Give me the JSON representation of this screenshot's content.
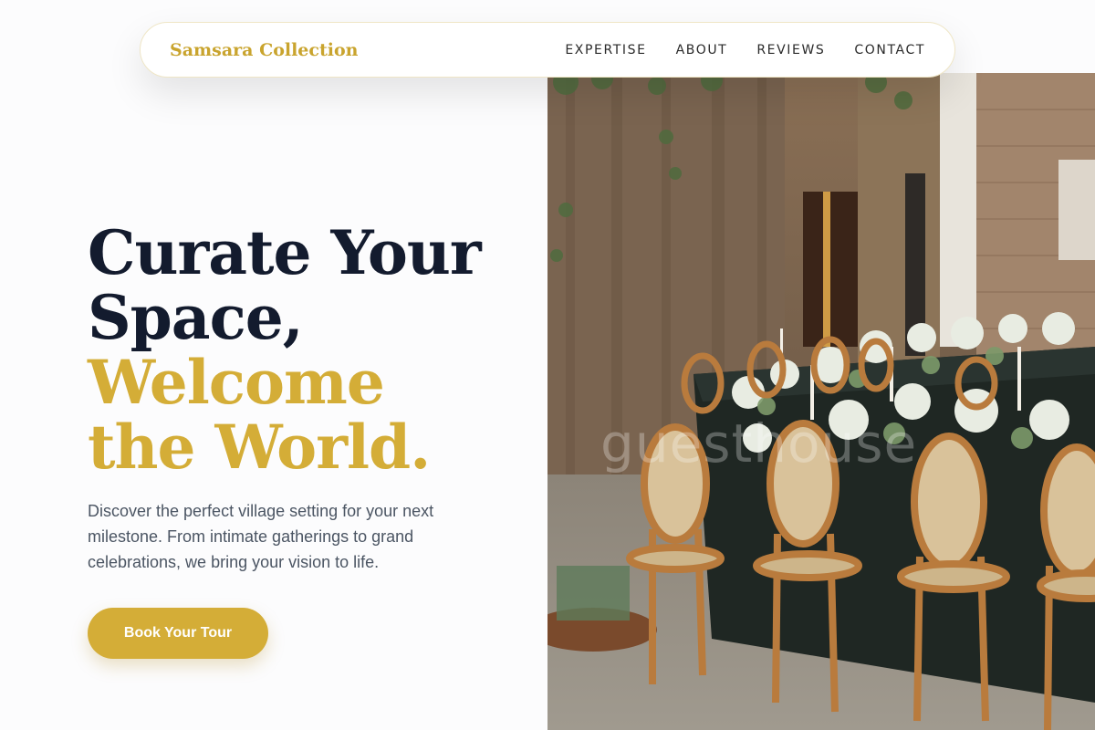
{
  "nav": {
    "brand": "Samsara Collection",
    "links": [
      "EXPERTISE",
      "ABOUT",
      "REVIEWS",
      "CONTACT"
    ]
  },
  "hero": {
    "headline_line1": "Curate Your",
    "headline_line2": "Space,",
    "headline_line3": "Welcome",
    "headline_line4": "the World.",
    "description": "Discover the perfect village setting for your next milestone. From intimate gatherings to grand celebrations, we bring your vision to life.",
    "cta_label": "Book Your Tour",
    "image_watermark": "guesthouse"
  },
  "colors": {
    "accent_gold": "#d4ad37",
    "heading_dark": "#131b2e",
    "body_text": "#4b5563",
    "brand_gold": "#c9a42e"
  }
}
